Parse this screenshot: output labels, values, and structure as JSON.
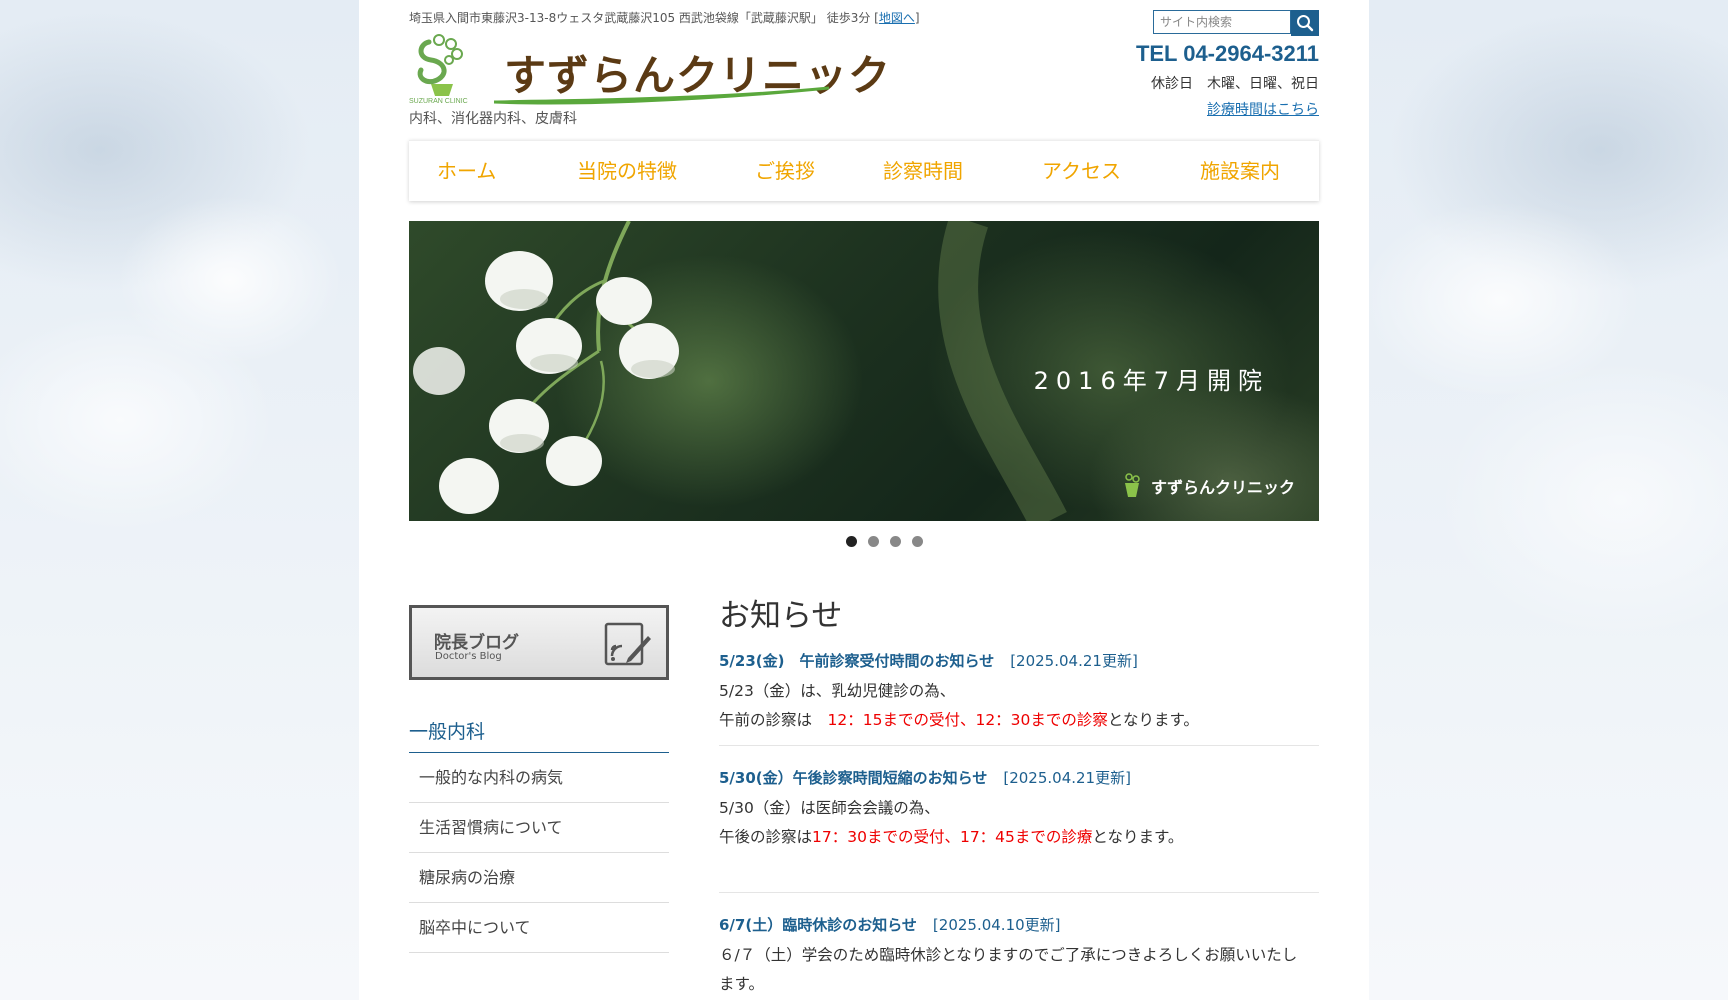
{
  "header": {
    "address": "埼玉県入間市東藤沢3-13-8ウェスタ武蔵藤沢105 西武池袋線「武蔵藤沢駅」 徒歩3分 [",
    "map_link": "地図へ",
    "address_end": "]",
    "logo_text": "すずらんクリニック",
    "logo_mark_text": "SUZURAN CLINIC",
    "tagline": "内科、消化器内科、皮膚科",
    "search_placeholder": "サイト内検索",
    "tel": "TEL 04-2964-3211",
    "closed_days": "休診日　木曜、日曜、祝日",
    "hours_link": "診療時間はこちら"
  },
  "nav": {
    "items": [
      "ホーム",
      "当院の特徴",
      "ご挨拶",
      "診察時間",
      "アクセス",
      "施設案内"
    ]
  },
  "hero": {
    "text": "2016年7月開院",
    "logo_text": "すずらんクリニック",
    "dots": 4,
    "active_dot": 0
  },
  "sidebar": {
    "blog_title": "院長ブログ",
    "blog_sub": "Doctor's Blog",
    "heading": "一般内科",
    "items": [
      "一般的な内科の病気",
      "生活習慣病について",
      "糖尿病の治療",
      "脳卒中について"
    ]
  },
  "main": {
    "heading": "お知らせ",
    "news": [
      {
        "title": "5/23(金)　午前診察受付時間のお知らせ",
        "date": "[2025.04.21更新]",
        "line1": "5/23（金）は、乳幼児健診の為、",
        "line2_pre": "午前の診察は　",
        "line2_red": "12：15までの受付、12：30までの診察",
        "line2_post": "となります。"
      },
      {
        "title": "5/30(金）午後診察時間短縮のお知らせ",
        "date": "[2025.04.21更新]",
        "line1": "5/30（金）は医師会会議の為、",
        "line2_pre": "午後の診察は",
        "line2_red": "17：30までの受付、17：45までの診療",
        "line2_post": "となります。"
      },
      {
        "title": "6/7(土）臨時休診のお知らせ",
        "date": "[2025.04.10更新]",
        "line1": "６/７（土）学会のため臨時休診となりますのでご了承につきよろしくお願いいたし",
        "line2": "ます。"
      }
    ]
  }
}
